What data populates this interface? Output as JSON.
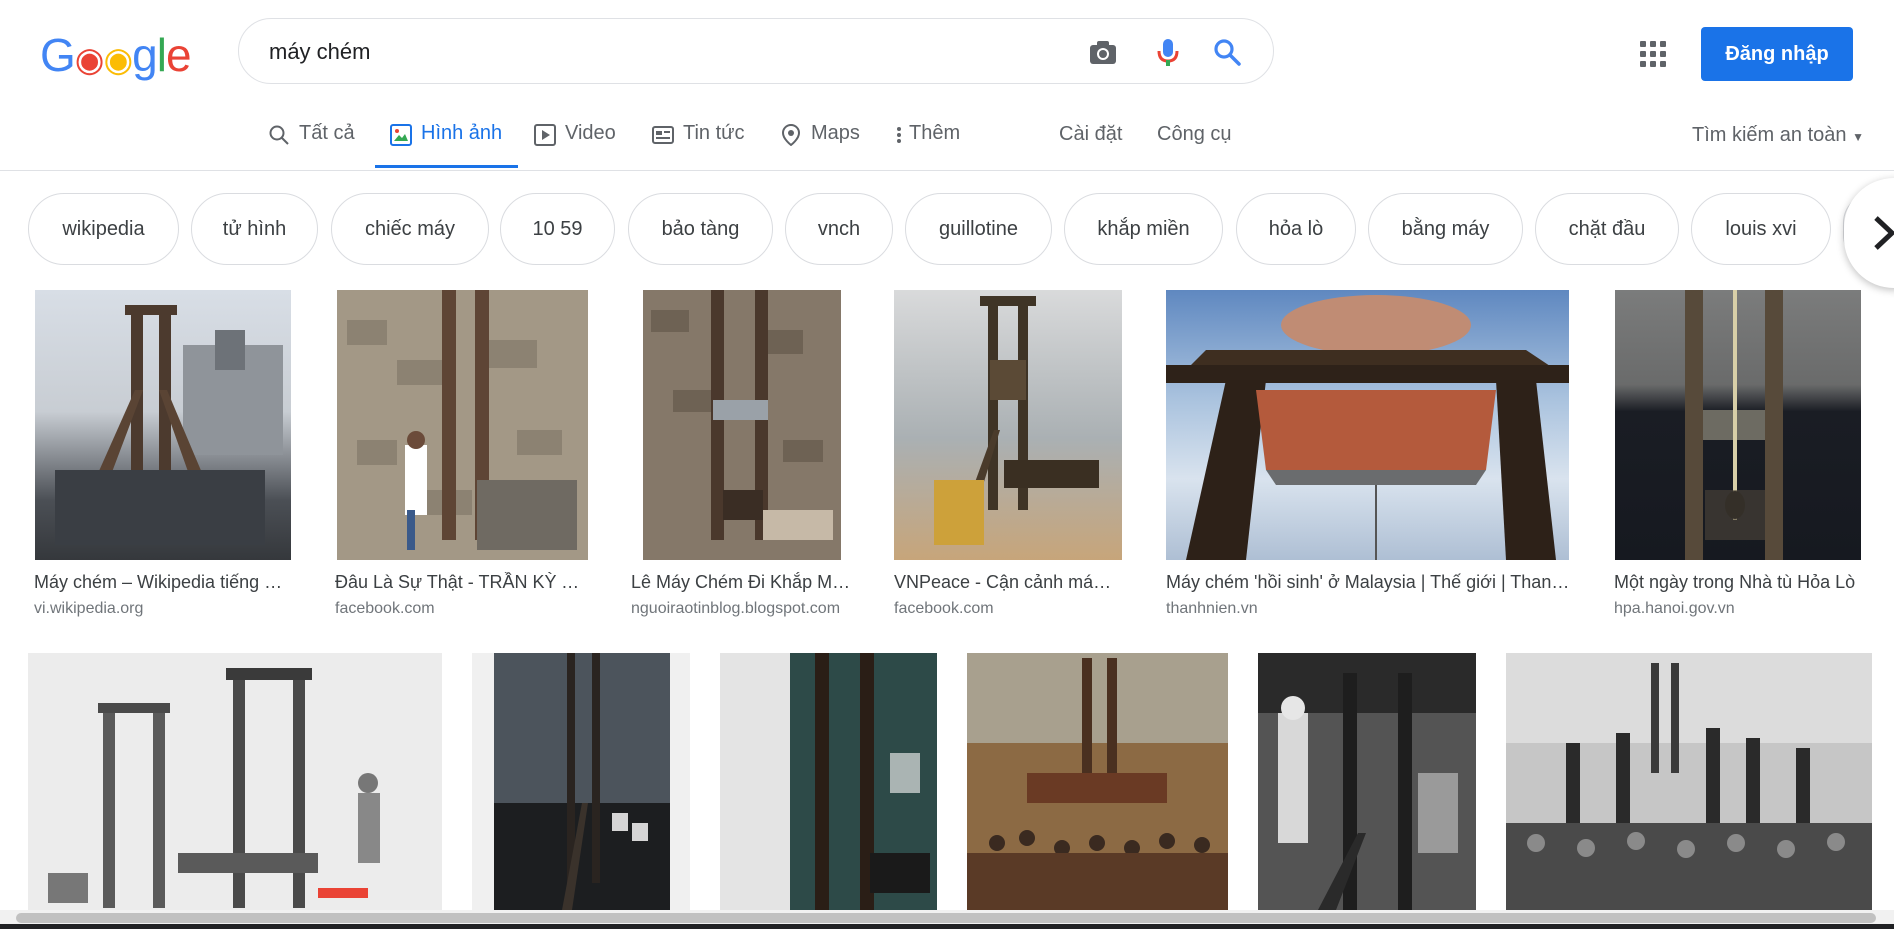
{
  "logo": "Google",
  "search": {
    "query": "máy chém"
  },
  "header": {
    "signin_label": "Đăng nhập"
  },
  "tabs": [
    {
      "label": "Tất cả",
      "icon": "search-icon"
    },
    {
      "label": "Hình ảnh",
      "icon": "image-icon",
      "active": true
    },
    {
      "label": "Video",
      "icon": "play-icon"
    },
    {
      "label": "Tin tức",
      "icon": "news-icon"
    },
    {
      "label": "Maps",
      "icon": "map-pin-icon"
    },
    {
      "label": "Thêm",
      "icon": "more-vert-icon"
    }
  ],
  "settings_label": "Cài đặt",
  "tools_label": "Công cụ",
  "safesearch_label": "Tìm kiếm an toàn",
  "chips": [
    "wikipedia",
    "tử hình",
    "chiếc máy",
    "10 59",
    "bảo tàng",
    "vnch",
    "guillotine",
    "khắp miền",
    "hỏa lò",
    "bằng máy",
    "chặt đầu",
    "louis xvi"
  ],
  "results_row1": [
    {
      "title": "Máy chém – Wikipedia tiếng Việt",
      "source": "vi.wikipedia.org"
    },
    {
      "title": "Đâu Là Sự Thật - TRẦN KỲ TRUNG",
      "source": "facebook.com"
    },
    {
      "title": "Lê Máy Chém Đi Khắp Miền Nam",
      "source": "nguoiraotinblog.blogspot.com"
    },
    {
      "title": "VNPeace - Cận cảnh máy chém",
      "source": "facebook.com"
    },
    {
      "title": "Máy chém 'hồi sinh' ở Malaysia | Thế giới | Thanh Niên",
      "source": "thanhnien.vn"
    },
    {
      "title": "Một ngày trong Nhà tù Hỏa Lò",
      "source": "hpa.hanoi.gov.vn"
    }
  ],
  "colors": {
    "accent": "#1a73e8",
    "logo": [
      "#4285f4",
      "#ea4335",
      "#fbbc05",
      "#4285f4",
      "#34a853",
      "#ea4335"
    ]
  }
}
